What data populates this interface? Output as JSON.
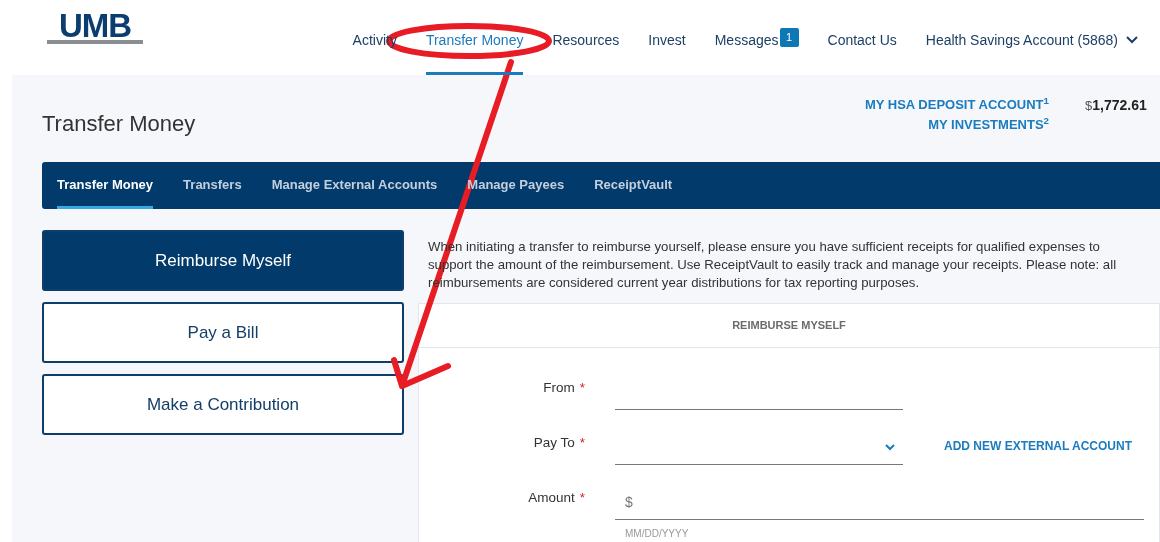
{
  "logo": {
    "text": "UMB"
  },
  "nav": [
    {
      "label": "Activity",
      "selected": false
    },
    {
      "label": "Transfer Money",
      "selected": true
    },
    {
      "label": "Resources",
      "selected": false
    },
    {
      "label": "Invest",
      "selected": false
    },
    {
      "label": "Messages",
      "selected": false,
      "badge": "1"
    },
    {
      "label": "Contact Us",
      "selected": false
    }
  ],
  "account_menu": {
    "label": "Health Savings Account (5868)"
  },
  "page_title": "Transfer Money",
  "balances": [
    {
      "label": "MY HSA DEPOSIT ACCOUNT$^{1}$",
      "currency": "$",
      "amount": "1,772.61"
    },
    {
      "label": "MY INVESTMENTS$^{2}$"
    }
  ],
  "tabs": [
    {
      "label": "Transfer Money",
      "selected": true
    },
    {
      "label": "Transfers",
      "selected": false
    },
    {
      "label": "Manage External Accounts",
      "selected": false
    },
    {
      "label": "Manage Payees",
      "selected": false
    },
    {
      "label": "ReceiptVault",
      "selected": false
    }
  ],
  "actions": [
    {
      "label": "Reimburse Myself",
      "selected": true
    },
    {
      "label": "Pay a Bill",
      "selected": false
    },
    {
      "label": "Make a Contribution",
      "selected": false
    }
  ],
  "notice": "When initiating a transfer to reimburse yourself, please ensure you have sufficient receipts for qualified expenses to support the amount of the reimbursement. Use ReceiptVault to easily track and manage your receipts. Please note: all reimbursements are considered current year distributions for tax reporting purposes.",
  "form": {
    "title": "REIMBURSE MYSELF",
    "fields": [
      {
        "kind": "text",
        "label": "From",
        "required": "*"
      },
      {
        "kind": "select",
        "label": "Pay To",
        "required": "*",
        "link": "ADD NEW EXTERNAL ACCOUNT"
      },
      {
        "kind": "amount",
        "label": "Amount",
        "required": "*",
        "prefix": "$"
      }
    ],
    "date_placeholder": "MM/DD/YYYY"
  }
}
